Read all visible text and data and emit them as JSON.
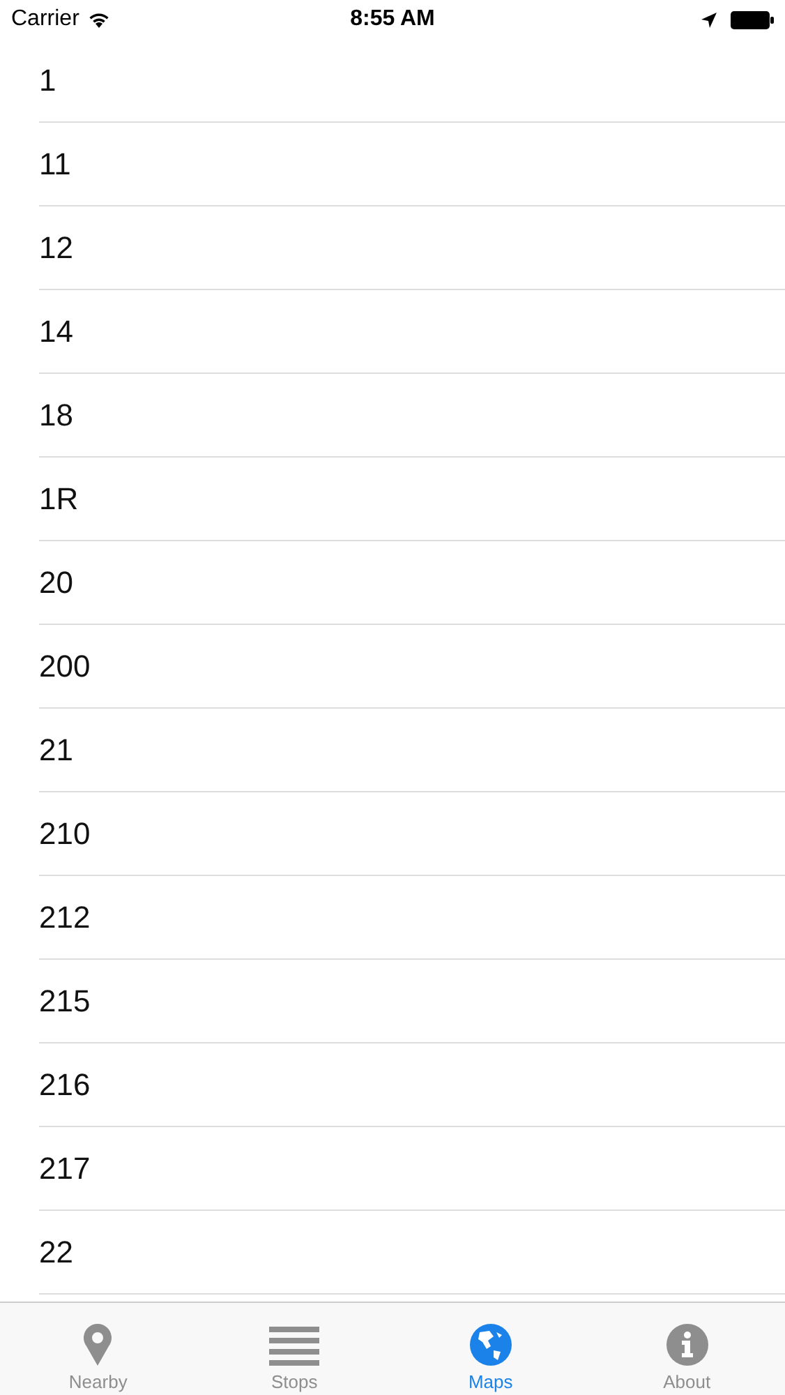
{
  "status_bar": {
    "carrier": "Carrier",
    "time": "8:55 AM"
  },
  "routes": [
    "1",
    "11",
    "12",
    "14",
    "18",
    "1R",
    "20",
    "200",
    "21",
    "210",
    "212",
    "215",
    "216",
    "217",
    "22"
  ],
  "tabs": [
    {
      "label": "Nearby",
      "kind": "pin",
      "selected": false
    },
    {
      "label": "Stops",
      "kind": "list",
      "selected": false
    },
    {
      "label": "Maps",
      "kind": "globe",
      "selected": true
    },
    {
      "label": "About",
      "kind": "info",
      "selected": false
    }
  ]
}
